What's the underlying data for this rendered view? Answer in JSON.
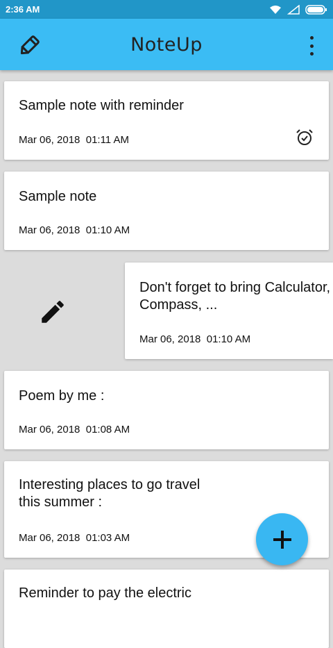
{
  "status_bar": {
    "time": "2:36 AM"
  },
  "app_bar": {
    "title": "NoteUp"
  },
  "notes": [
    {
      "title": "Sample note with reminder",
      "date": "Mar 06, 2018  01:11 AM",
      "has_reminder": true
    },
    {
      "title": "Sample note",
      "date": "Mar 06, 2018  01:10 AM"
    },
    {
      "title": "Don't forget to bring Calculator,\nCompass, ...",
      "date": "Mar 06, 2018  01:10 AM",
      "swiped": true
    },
    {
      "title": "Poem by me :",
      "date": "Mar 06, 2018  01:08 AM"
    },
    {
      "title": "Interesting places to go travel\nthis summer :",
      "date": "Mar 06, 2018  01:03 AM"
    },
    {
      "title": "Reminder to pay the electric",
      "date": ""
    }
  ],
  "colors": {
    "status_bar": "#2196c8",
    "app_bar": "#3bbcf4",
    "fab": "#39b7f2",
    "background": "#dcdcdc"
  },
  "icons": {
    "logo": "pencil-icon",
    "menu": "more-vert-icon",
    "reminder": "alarm-check-icon",
    "swipe_action": "edit-icon",
    "fab": "add-icon"
  }
}
